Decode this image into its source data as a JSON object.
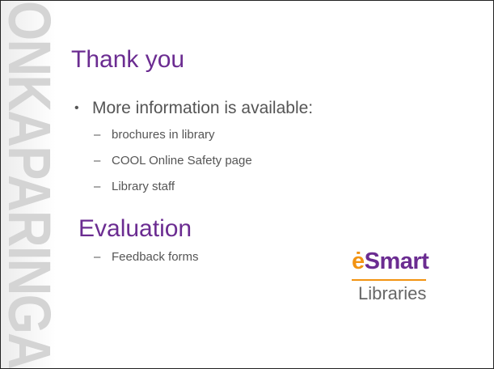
{
  "slide": {
    "side_logo_text": "ONKAPARINGA",
    "title": "Thank you",
    "bullet": "More information is available:",
    "subitems": [
      "brochures in library",
      "COOL Online Safety page",
      "Library staff"
    ],
    "heading2": "Evaluation",
    "eval_items": [
      "Feedback forms"
    ],
    "logo": {
      "e_letter": "ė",
      "brand_rest": "Smart",
      "sub": "Libraries"
    }
  },
  "colors": {
    "title": "#6b2c91",
    "text": "#555555",
    "logo_orange": "#f29312",
    "side_band": "#d4d4d4"
  }
}
